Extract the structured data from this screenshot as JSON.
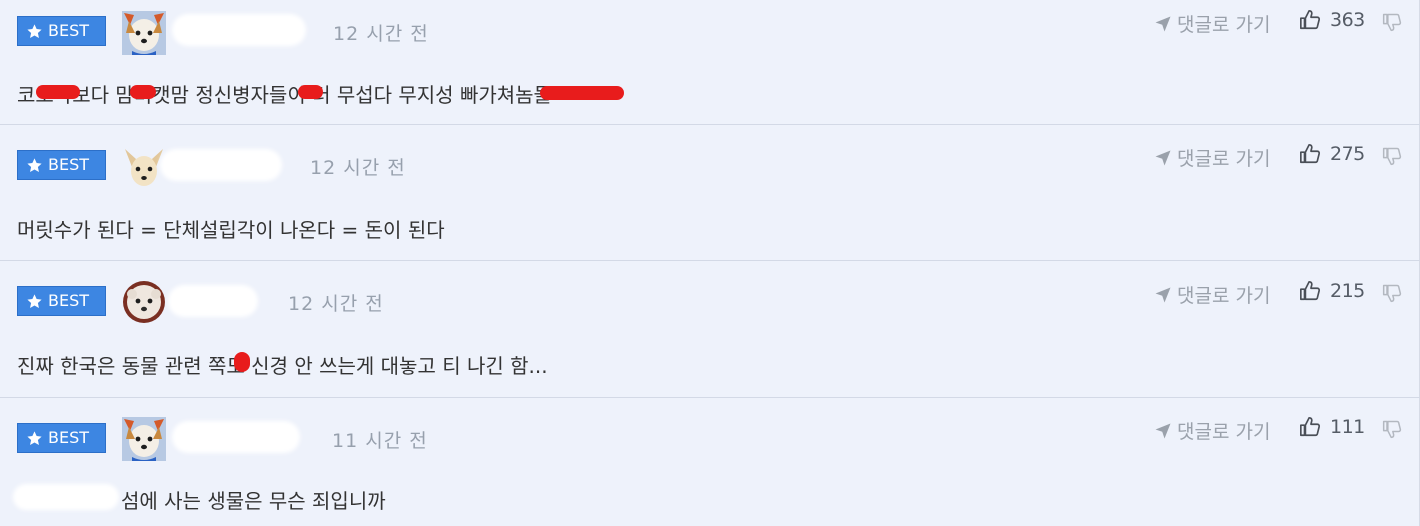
{
  "colors": {
    "background": "#eef2fb",
    "best_badge": "#3d86e2",
    "redaction_mark": "#e81c1c",
    "muted_text": "#97a0ad"
  },
  "icons": {
    "best_badge": "star-icon",
    "reply": "send-arrow-icon",
    "like": "thumbs-up-icon",
    "dislike": "thumbs-down-icon"
  },
  "comments": [
    {
      "badge": "BEST",
      "time": "12 시간 전",
      "reply_label": "댓글로 가기",
      "likes": "363",
      "text": "코로나보다 맘미캣맘 정신병자들이 더 무섭다 무지성 빠가쳐놈들"
    },
    {
      "badge": "BEST",
      "time": "12 시간 전",
      "reply_label": "댓글로 가기",
      "likes": "275",
      "text": "머릿수가 된다 = 단체설립각이 나온다 = 돈이 된다"
    },
    {
      "badge": "BEST",
      "time": "12 시간 전",
      "reply_label": "댓글로 가기",
      "likes": "215",
      "text": "진짜 한국은 동물 관련 쪽도 신경 안 쓰는게 대놓고 티 나긴 함..."
    },
    {
      "badge": "BEST",
      "time": "11 시간 전",
      "reply_label": "댓글로 가기",
      "likes": "111",
      "text": "섬에 사는 생물은 무슨 죄입니까"
    }
  ]
}
